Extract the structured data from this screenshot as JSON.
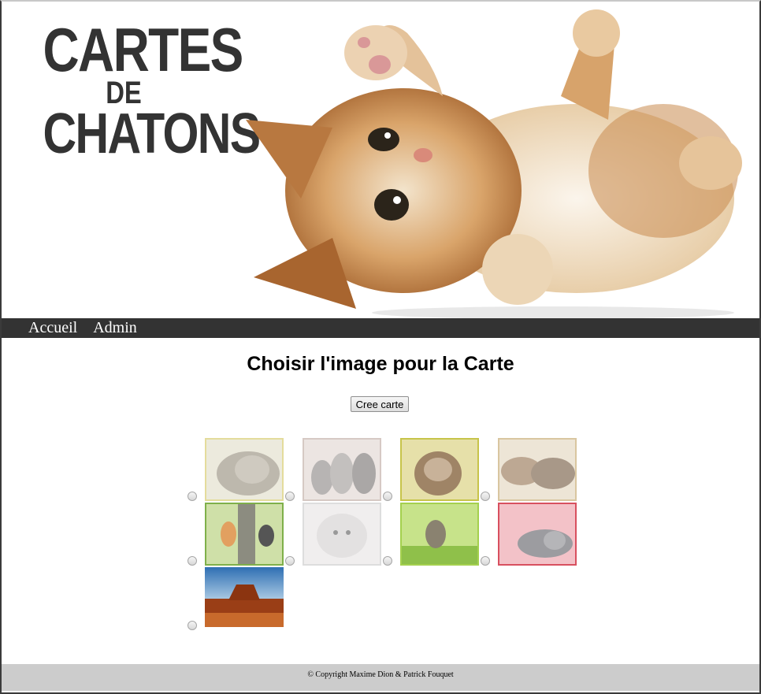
{
  "logo": {
    "line1": "CARTES",
    "line2": "DE",
    "line3": "CHATONS"
  },
  "nav": {
    "items": [
      "Accueil",
      "Admin"
    ]
  },
  "main": {
    "title": "Choisir l'image pour la Carte",
    "create_button": "Cree carte",
    "images": [
      {
        "name": "sleeping-gray-kitten"
      },
      {
        "name": "three-kittens-sitting"
      },
      {
        "name": "fluffy-kitten-portrait"
      },
      {
        "name": "kittens-sleeping-pile"
      },
      {
        "name": "kittens-on-tree"
      },
      {
        "name": "white-kitten"
      },
      {
        "name": "kitten-running-grass"
      },
      {
        "name": "kitten-on-pink-blanket"
      },
      {
        "name": "desert-mesa-landscape"
      }
    ]
  },
  "footer": {
    "text": "© Copyright Maxime Dion & Patrick Fouquet"
  },
  "colors": {
    "nav_bg": "#333333",
    "footer_bg": "#cccccc",
    "logo_text": "#333333"
  }
}
